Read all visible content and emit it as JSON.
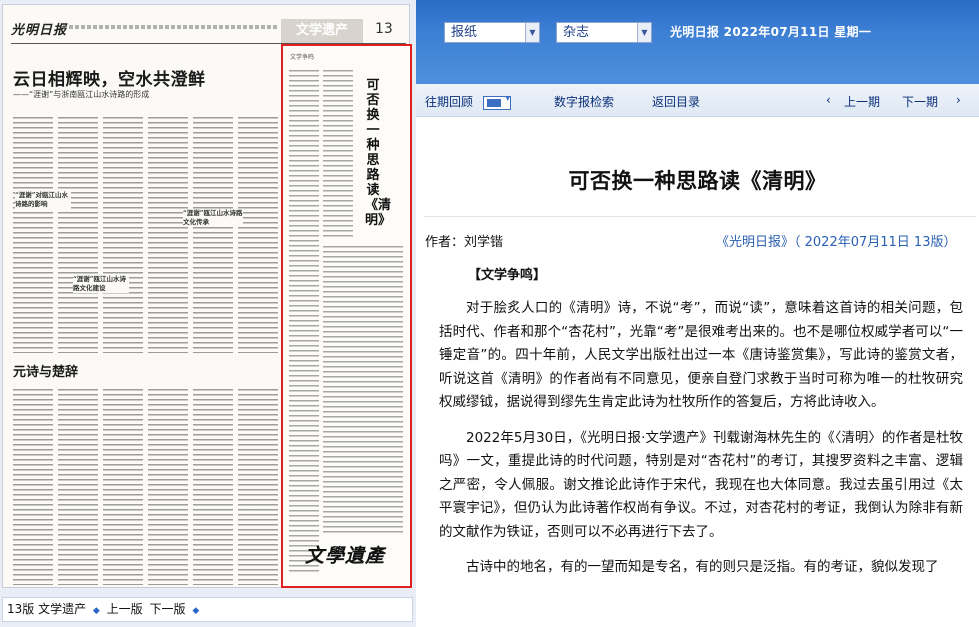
{
  "paper_preview": {
    "masthead": "光明日报",
    "section_banner": "文学遗产",
    "page_number": "13",
    "headline": "云日相辉映，空水共澄鲜",
    "subheadline": "——“涯谢”与浙南瓯江山水诗路的形成",
    "inset_1": "“涯谢”对瓯江山水诗路的影响",
    "inset_2": "“涯谢”瓯江山水诗路文化传承",
    "inset_3": "“涯谢”瓯江山水诗路文化建设",
    "second_headline": "元诗与楚辞",
    "highlight_title": "可否换一种思路读《清明》",
    "highlight_tag": "文学争鸣",
    "logo_text": "文學遺產"
  },
  "page_footer": {
    "current": "13版 文学遗产",
    "prev_label": "上一版",
    "next_label": "下一版"
  },
  "top_bar": {
    "select_newspaper": "报纸",
    "select_magazine": "杂志",
    "date_text": "光明日报 2022年07月11日 星期一"
  },
  "nav": {
    "past": "往期回顾",
    "search": "数字报检索",
    "back": "返回目录",
    "prev": "上一期",
    "next": "下一期"
  },
  "article": {
    "title": "可否换一种思路读《清明》",
    "author": "作者：刘学锴",
    "source": "《光明日报》（ 2022年07月11日   13版）",
    "column": "【文学争鸣】",
    "paragraphs": [
      "对于脍炙人口的《清明》诗，不说“考”，而说“读”，意味着这首诗的相关问题，包括时代、作者和那个“杏花村”，光靠“考”是很难考出来的。也不是哪位权威学者可以“一锤定音”的。四十年前，人民文学出版社出过一本《唐诗鉴赏集》，写此诗的鉴赏文者，听说这首《清明》的作者尚有不同意见，便亲自登门求教于当时可称为唯一的杜牧研究权威缪钺，据说得到缪先生肯定此诗为杜牧所作的答复后，方将此诗收入。",
      "2022年5月30日，《光明日报·文学遗产》刊载谢海林先生的《〈清明〉的作者是杜牧吗》一文，重提此诗的时代问题，特别是对“杏花村”的考订，其搜罗资料之丰富、逻辑之严密，令人佩服。谢文推论此诗作于宋代，我现在也大体同意。我过去虽引用过《太平寰宇记》，但仍认为此诗著作权尚有争议。不过，对杏花村的考证，我倒认为除非有新的文献作为铁证，否则可以不必再进行下去了。",
      "古诗中的地名，有的一望而知是专名，有的则只是泛指。有的考证，貌似发现了"
    ]
  }
}
